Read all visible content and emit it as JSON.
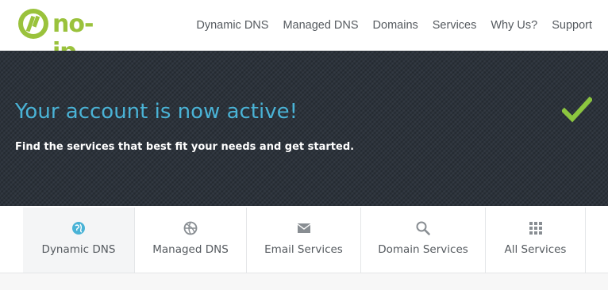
{
  "brand": {
    "logo_text": "no-ip",
    "accent_color": "#9ac23c"
  },
  "nav": {
    "items": [
      "Dynamic DNS",
      "Managed DNS",
      "Domains",
      "Services",
      "Why Us?",
      "Support"
    ]
  },
  "hero": {
    "title": "Your account is now active!",
    "subtitle": "Find the services that best fit your needs and get started.",
    "title_color": "#4ab3d6",
    "check_icon": "checkmark-icon",
    "check_color": "#8cc63f"
  },
  "services": {
    "tabs": [
      {
        "label": "Dynamic DNS",
        "icon": "globe-icon",
        "active": true
      },
      {
        "label": "Managed DNS",
        "icon": "basketball-icon",
        "active": false
      },
      {
        "label": "Email Services",
        "icon": "envelope-icon",
        "active": false
      },
      {
        "label": "Domain Services",
        "icon": "search-icon",
        "active": false
      },
      {
        "label": "All Services",
        "icon": "grid-icon",
        "active": false
      }
    ]
  }
}
